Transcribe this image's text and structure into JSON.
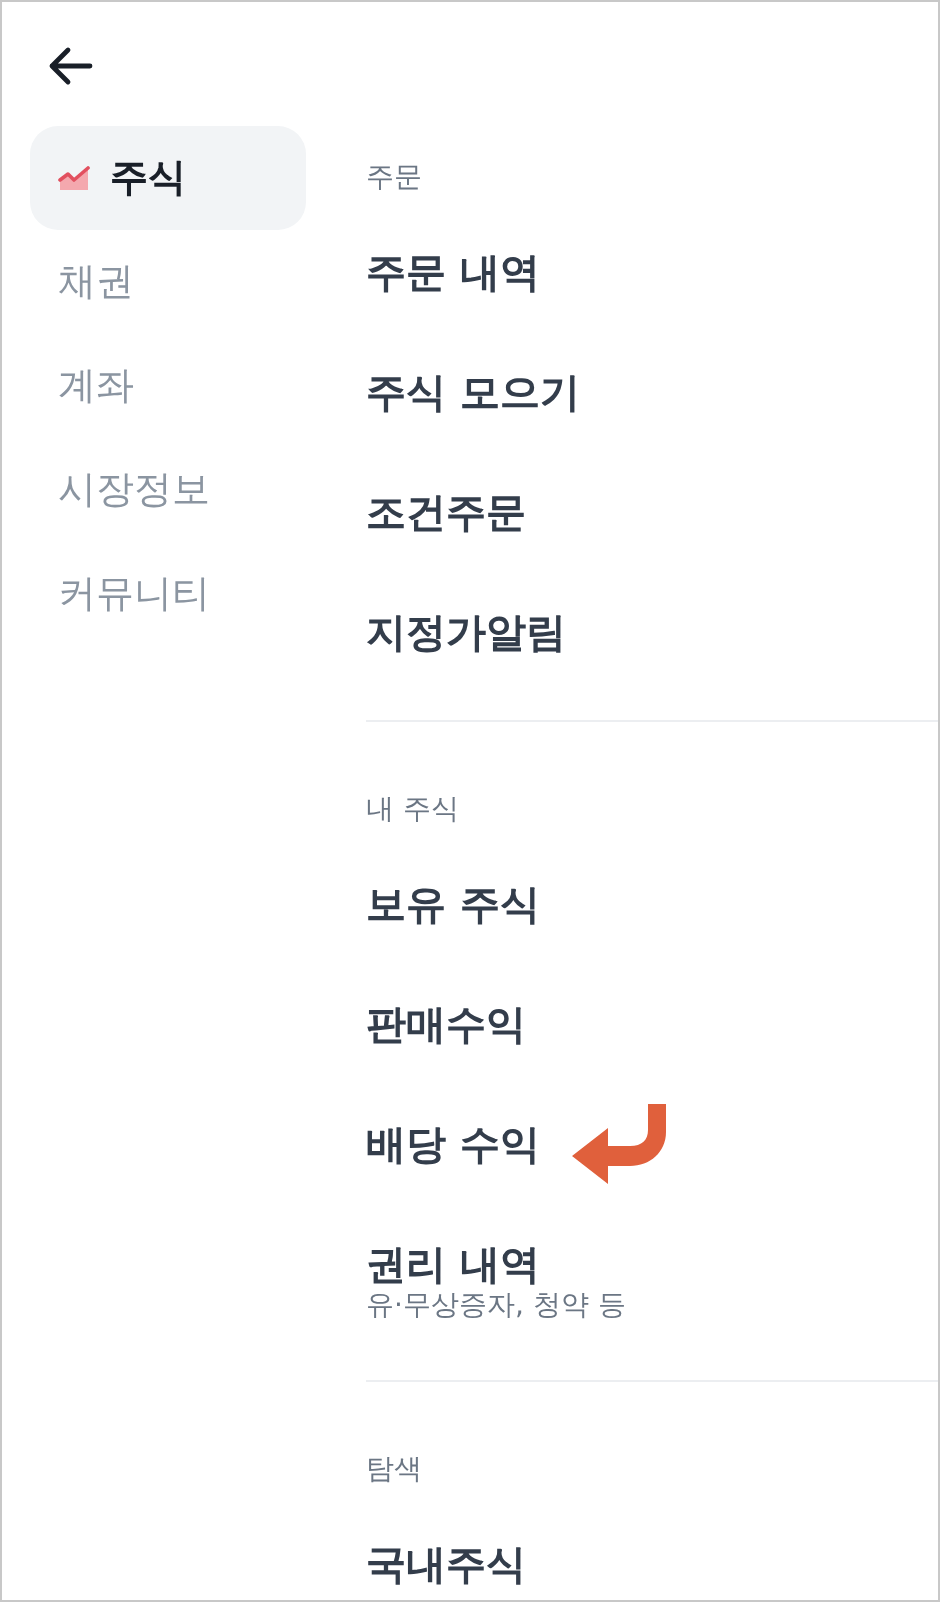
{
  "sidebar": {
    "items": [
      {
        "label": "주식",
        "selected": true
      },
      {
        "label": "채권",
        "selected": false
      },
      {
        "label": "계좌",
        "selected": false
      },
      {
        "label": "시장정보",
        "selected": false
      },
      {
        "label": "커뮤니티",
        "selected": false
      }
    ]
  },
  "sections": [
    {
      "title": "주문",
      "items": [
        {
          "label": "주문 내역",
          "pointed": false
        },
        {
          "label": "주식 모으기",
          "pointed": false
        },
        {
          "label": "조건주문",
          "pointed": false
        },
        {
          "label": "지정가알림",
          "pointed": false
        }
      ]
    },
    {
      "title": "내 주식",
      "items": [
        {
          "label": "보유 주식",
          "pointed": false
        },
        {
          "label": "판매수익",
          "pointed": false
        },
        {
          "label": "배당 수익",
          "pointed": true
        },
        {
          "label": "권리 내역",
          "subtitle": "유·무상증자, 청약 등",
          "pointed": false
        }
      ]
    },
    {
      "title": "탐색",
      "items": [
        {
          "label": "국내주식",
          "pointed": false
        }
      ]
    }
  ]
}
